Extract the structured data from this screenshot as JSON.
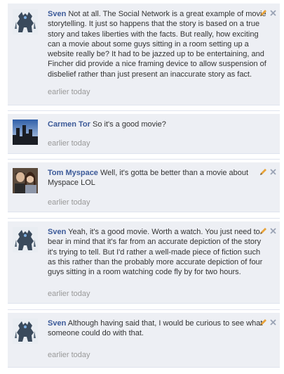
{
  "comments": [
    {
      "author": "Sven",
      "avatar": "robot-warrior-avatar",
      "text": "Not at all. The Social Network is a great example of movie storytelling. It just so happens that the story is based on a true story and takes liberties with the facts. But really, how exciting can a movie about some guys sitting in a room setting up a website really be? It had to be jazzed up to be entertaining, and Fincher did provide a nice framing device to allow suspension of disbelief rather than just present an inaccurate story as fact.",
      "time": "earlier today"
    },
    {
      "author": "Carmen Tor",
      "avatar": "city-skyline-avatar",
      "text": "So it's a good movie?",
      "time": "earlier today"
    },
    {
      "author": "Tom Myspace",
      "avatar": "couple-photo-avatar",
      "text": "Well, it's gotta be better than a movie about Myspace LOL",
      "time": "earlier today"
    },
    {
      "author": "Sven",
      "avatar": "robot-warrior-avatar",
      "text": "Yeah, it's a good movie. Worth a watch. You just need to bear in mind that it's far from an accurate depiction of the story it's trying to tell. But I'd rather a well-made piece of fiction such as this rather than the probably more accurate depiction of four guys sitting in a room watching code fly by for two hours.",
      "time": "earlier today"
    },
    {
      "author": "Sven",
      "avatar": "robot-warrior-avatar",
      "text": "Although having said that, I would be curious to see what someone could do with that.",
      "time": "earlier today"
    }
  ],
  "icons": {
    "edit": "pencil-icon",
    "delete": "close-icon"
  },
  "colors": {
    "comment_bg": "#edeff4",
    "author_link": "#3b5998",
    "timestamp": "#999999",
    "pencil": "#e8a33a",
    "close": "#9aa3b5"
  }
}
